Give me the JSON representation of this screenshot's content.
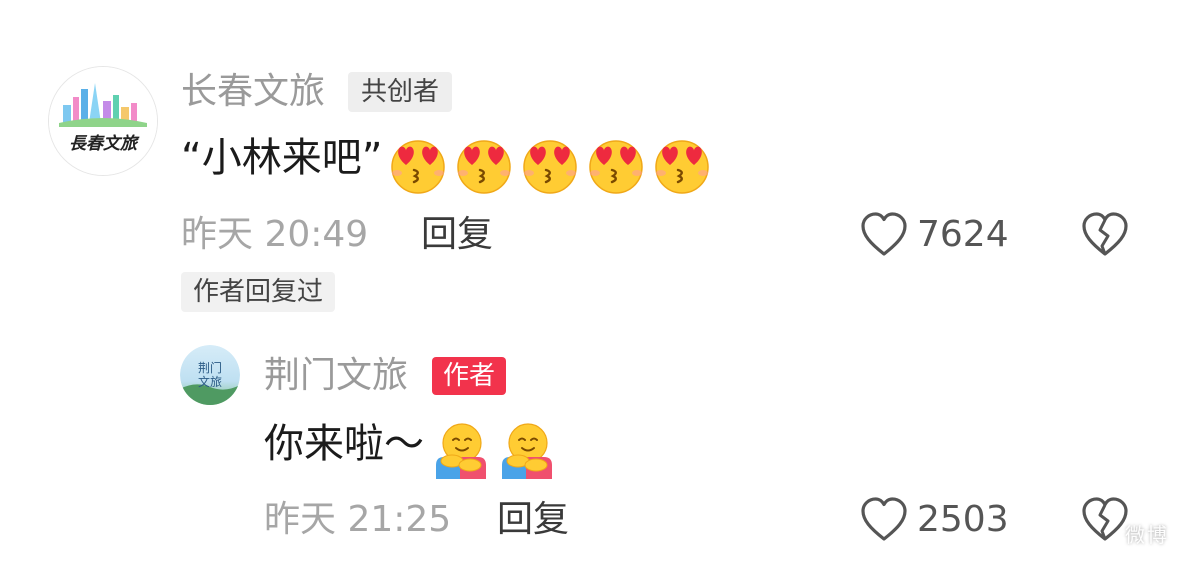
{
  "comment": {
    "author": "长春文旅",
    "badge": "共创者",
    "avatar_text": "長春文旅",
    "text": "“小林来吧”",
    "emojis": [
      "smiling-face-with-heart-eyes-icon",
      "smiling-face-with-heart-eyes-icon",
      "smiling-face-with-heart-eyes-icon",
      "smiling-face-with-heart-eyes-icon",
      "smiling-face-with-heart-eyes-icon"
    ],
    "time": "昨天 20:49",
    "reply_label": "回复",
    "likes": "7624",
    "author_replied": "作者回复过"
  },
  "reply": {
    "author": "荆门文旅",
    "badge": "作者",
    "avatar_text": "荆门文旅",
    "text": "你来啦～",
    "emojis": [
      "hugging-face-icon",
      "hugging-face-icon"
    ],
    "time": "昨天 21:25",
    "reply_label": "回复",
    "likes": "2503"
  },
  "watermark": "微博"
}
